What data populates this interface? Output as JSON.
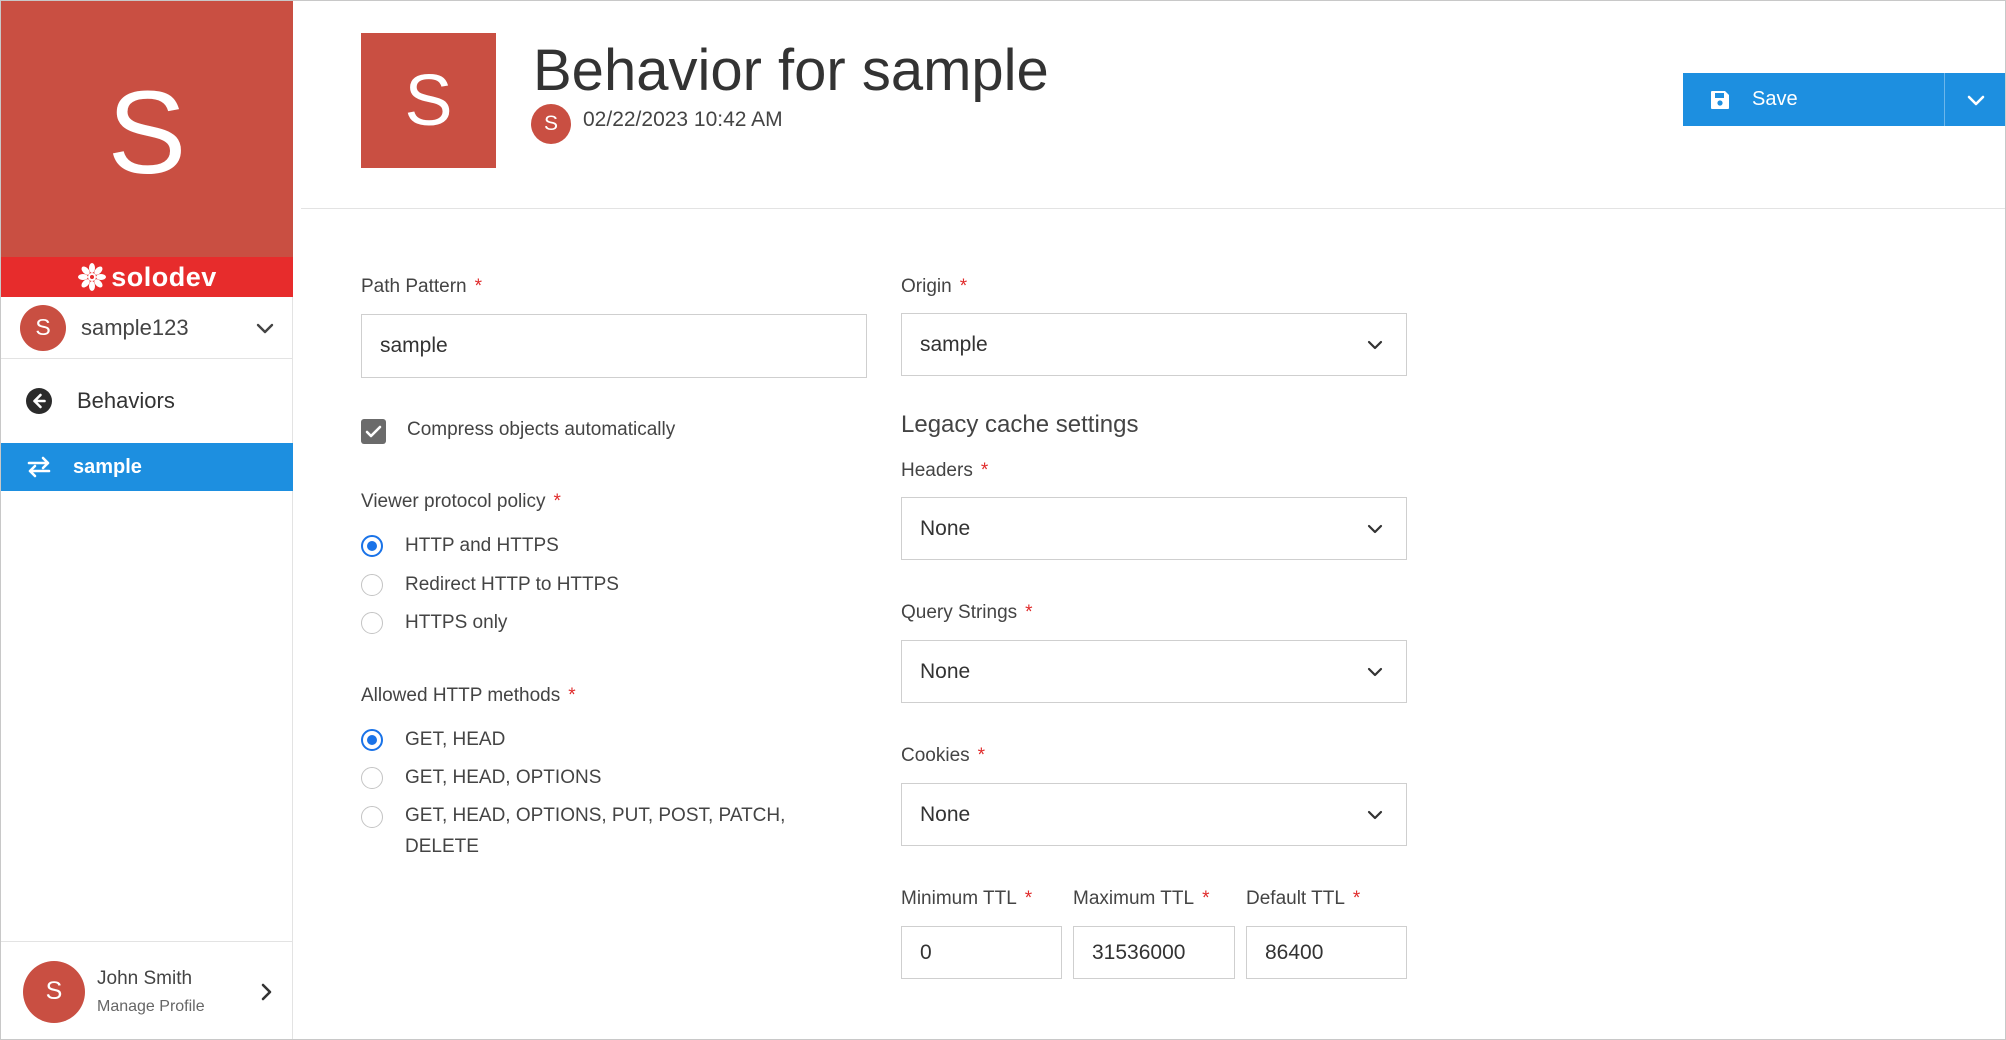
{
  "sidebar": {
    "brand_letter": "S",
    "logo_text": "solodev",
    "account": {
      "avatar": "S",
      "name": "sample123"
    },
    "nav": {
      "back_label": "Behaviors",
      "active_label": "sample"
    },
    "profile": {
      "avatar": "S",
      "name": "John Smith",
      "sub": "Manage Profile"
    }
  },
  "header": {
    "tile_letter": "S",
    "title": "Behavior for sample",
    "avatar": "S",
    "timestamp": "02/22/2023 10:42 AM",
    "save_label": "Save"
  },
  "form": {
    "path_pattern": {
      "label": "Path Pattern",
      "value": "sample",
      "required": "*"
    },
    "compress": {
      "label": "Compress objects automatically",
      "checked": true
    },
    "viewer_protocol": {
      "label": "Viewer protocol policy",
      "required": "*",
      "options": [
        "HTTP and HTTPS",
        "Redirect HTTP to HTTPS",
        "HTTPS only"
      ],
      "selected": "HTTP and HTTPS"
    },
    "allowed_methods": {
      "label": "Allowed HTTP methods",
      "required": "*",
      "options": [
        "GET, HEAD",
        "GET, HEAD, OPTIONS",
        "GET, HEAD, OPTIONS, PUT, POST, PATCH,",
        "DELETE"
      ],
      "selected": "GET, HEAD"
    },
    "origin": {
      "label": "Origin",
      "value": "sample",
      "required": "*"
    },
    "legacy_title": "Legacy cache settings",
    "headers": {
      "label": "Headers",
      "value": "None",
      "required": "*"
    },
    "query_strings": {
      "label": "Query Strings",
      "value": "None",
      "required": "*"
    },
    "cookies": {
      "label": "Cookies",
      "value": "None",
      "required": "*"
    },
    "min_ttl": {
      "label": "Minimum TTL",
      "value": "0",
      "required": "*"
    },
    "max_ttl": {
      "label": "Maximum TTL",
      "value": "31536000",
      "required": "*"
    },
    "default_ttl": {
      "label": "Default TTL",
      "value": "86400",
      "required": "*"
    }
  },
  "colors": {
    "brand": "#c94f42",
    "logo_bar": "#e72c2c",
    "accent": "#1d8fe0",
    "radio_selected": "#1a73e8",
    "required": "#e02b2b"
  },
  "icons": {
    "logo": "solodev-flower-icon",
    "account_toggle": "chevron-down-icon",
    "back": "arrow-left-circle-icon",
    "active_item": "swap-arrows-icon",
    "save": "floppy-disk-icon",
    "save_menu": "chevron-down-icon",
    "select": "chevron-down-icon",
    "profile": "chevron-right-icon"
  }
}
